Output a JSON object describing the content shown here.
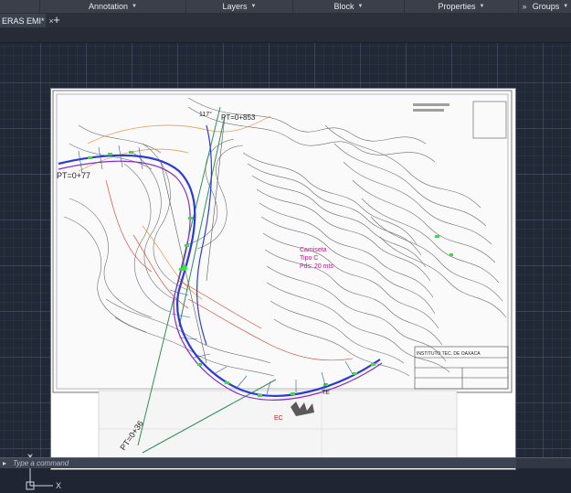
{
  "ribbon": {
    "panels": [
      {
        "label": "Annotation"
      },
      {
        "label": "Layers"
      },
      {
        "label": "Block"
      },
      {
        "label": "Properties"
      },
      {
        "label": "Groups"
      }
    ],
    "overflow_glyph": "»"
  },
  "document_tab": {
    "title": "ERAS EMI*",
    "close_glyph": "×",
    "new_tab_glyph": "+"
  },
  "drawing": {
    "labels": {
      "station_top": "PT=0+77",
      "station_left": "PT=0+853",
      "station_bottom": "PT=0+36",
      "curve_ec": "EC",
      "curve_te": "TE",
      "angle": "117°",
      "note_line1": "Camiseta",
      "note_line2": "Tipo C",
      "note_line3": "Pds: 20 mts",
      "title_block": "INSTITUTO TEC. DE OAXACA"
    }
  },
  "ucs": {
    "x_label": "X",
    "y_label": "Y"
  },
  "command_line": {
    "placeholder": "Type a command",
    "chevron": "▸"
  },
  "colors": {
    "canvas_bg": "#222936",
    "ribbon_bg": "#3a3f49",
    "paper": "#ffffff",
    "alignment_blue": "#2a3bd6",
    "alignment_purple": "#8a2cc4",
    "axis_green": "#2f8f5a",
    "marker_green": "#2ee82e",
    "contour_orange": "#e08a2a",
    "note_magenta": "#b0208a"
  }
}
